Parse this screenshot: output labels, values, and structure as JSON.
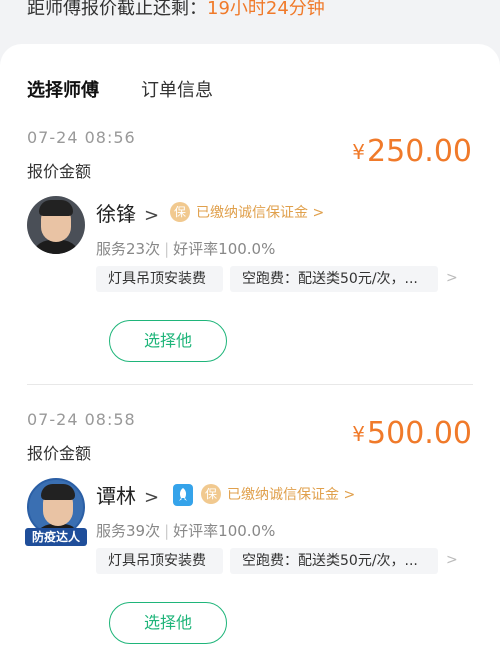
{
  "countdown": {
    "prefix": "距师傅报价截止还剩：",
    "time": "19小时24分钟"
  },
  "tabs": [
    {
      "label": "选择师傅",
      "active": true
    },
    {
      "label": "订单信息",
      "active": false
    }
  ],
  "colors": {
    "accent": "#1fb57a",
    "price": "#f07a2a",
    "guarantee": "#e0a04c"
  },
  "quotes": [
    {
      "time": "07-24 08:56",
      "label": "报价金额",
      "currency": "¥",
      "amount": "250.00",
      "name": "徐锋",
      "chevron": ">",
      "guarantee_icon": "保",
      "guarantee_text": "已缴纳诚信保证金 >",
      "services": "服务23次",
      "separator": "|",
      "rating": "好评率100.0%",
      "tags": [
        "灯具吊顶安装费",
        "空跑费：配送类50元/次，..."
      ],
      "tags_more": ">",
      "button": "选择他"
    },
    {
      "time": "07-24 08:58",
      "label": "报价金额",
      "currency": "¥",
      "amount": "500.00",
      "name": "谭林",
      "chevron": ">",
      "pro_icon": "rocket-icon",
      "guarantee_icon": "保",
      "guarantee_text": "已缴纳诚信保证金 >",
      "avatar_badge": "防疫达人",
      "services": "服务39次",
      "separator": "|",
      "rating": "好评率100.0%",
      "tags": [
        "灯具吊顶安装费",
        "空跑费：配送类50元/次，..."
      ],
      "tags_more": ">",
      "button": "选择他"
    }
  ]
}
